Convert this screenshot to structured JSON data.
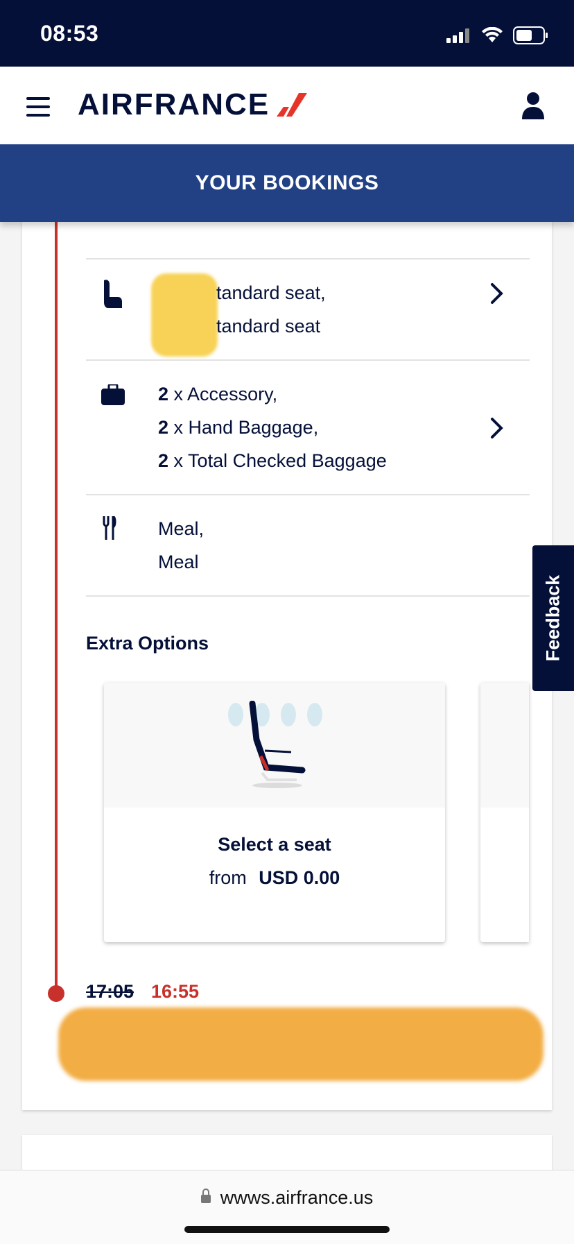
{
  "status": {
    "time": "08:53"
  },
  "header": {
    "brand": "AIRFRANCE"
  },
  "page": {
    "title": "YOUR BOOKINGS"
  },
  "seat": {
    "line1": "tandard seat,",
    "line2": "tandard seat"
  },
  "baggage": [
    {
      "count": "2",
      "label": " x Accessory,"
    },
    {
      "count": "2",
      "label": " x Hand Baggage,"
    },
    {
      "count": "2",
      "label": " x Total Checked Baggage"
    }
  ],
  "meal": {
    "line1": "Meal,",
    "line2": "Meal"
  },
  "extra": {
    "title": "Extra Options",
    "option": {
      "title": "Select a seat",
      "from": "from",
      "price": "USD 0.00"
    }
  },
  "feedback": {
    "label": "Feedback"
  },
  "arrival": {
    "old_time": "17:05",
    "new_time": "16:55"
  },
  "browser": {
    "url": "wwws.airfrance.us"
  },
  "colors": {
    "navy": "#051039",
    "blue": "#224184",
    "red": "#c8312b"
  }
}
